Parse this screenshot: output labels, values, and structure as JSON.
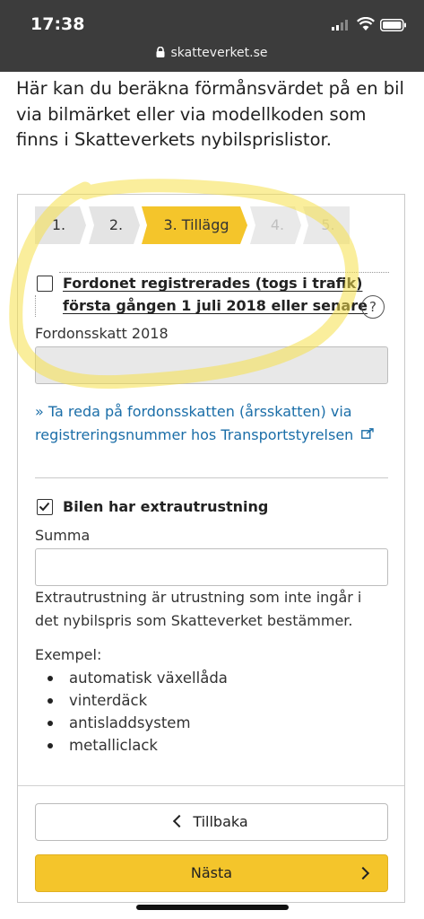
{
  "status_bar": {
    "time": "17:38"
  },
  "browser": {
    "url": "skatteverket.se"
  },
  "intro_text": "Här kan du beräkna förmånsvärdet på en bil via bilmärket eller via modellkoden som finns i Skatteverkets nybilsprislistor.",
  "steps": [
    {
      "label": "1.",
      "state": "done"
    },
    {
      "label": "2.",
      "state": "done"
    },
    {
      "label": "3. Tillägg",
      "state": "active"
    },
    {
      "label": "4.",
      "state": "upcoming"
    },
    {
      "label": "5.",
      "state": "upcoming"
    }
  ],
  "registered_checkbox": {
    "line1": "Fordonet registrerades (togs i trafik)",
    "line2": "första gången 1 juli 2018 eller senare",
    "checked": false
  },
  "help_icon": "?",
  "vehicle_tax": {
    "label": "Fordonsskatt 2018",
    "value": ""
  },
  "transport_link": {
    "line1": "» Ta reda på fordonsskatten (årsskatten) via",
    "line2": "registreringsnummer hos Transportstyrelsen"
  },
  "extras_checkbox": {
    "label": "Bilen har extrautrustning",
    "checked": true
  },
  "sum_field": {
    "label": "Summa",
    "value": ""
  },
  "extras_description": "Extrautrustning är utrustning som inte ingår i det nybilspris som Skatteverket bestämmer.",
  "examples_heading": "Exempel:",
  "examples": [
    "automatisk växellåda",
    "vinterdäck",
    "antisladdsystem",
    "metalliclack"
  ],
  "buttons": {
    "back": "Tillbaka",
    "next": "Nästa"
  },
  "colors": {
    "accent": "#f4c52b",
    "link": "#1b6ea8",
    "highlight": "#f5e04a"
  }
}
